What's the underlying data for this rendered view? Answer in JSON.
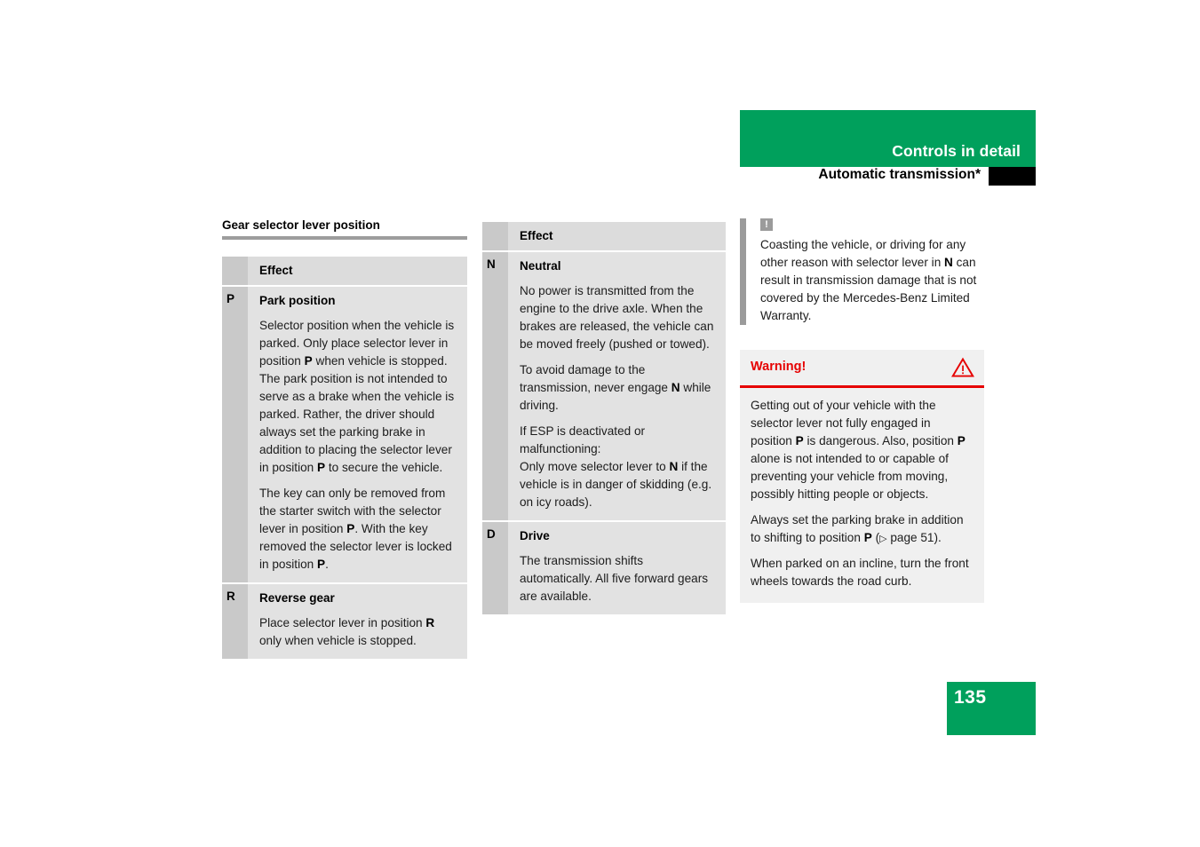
{
  "header": {
    "section_title": "Controls in detail",
    "subtitle": "Automatic transmission*",
    "band_color": "#00a05c",
    "tab_color": "#000000"
  },
  "page_number": "135",
  "section": {
    "title": "Gear selector lever position"
  },
  "tables": [
    {
      "id": "left",
      "header_letter": "",
      "header_label": "Effect",
      "rows": [
        {
          "letter": "P",
          "title": "Park position",
          "paragraphs": [
            "Selector position when the vehicle is parked. Only place selector lever in position <b>P</b> when vehicle is stopped. The park position is not intended to serve as a brake when the vehicle is parked. Rather, the driver should always set the parking brake in addition to placing the selector lever in position <b>P</b> to secure the vehicle.",
            "The key can only be removed from the starter switch with the selector lever in position <b>P</b>. With the key removed the selector lever is locked in position <b>P</b>."
          ]
        },
        {
          "letter": "R",
          "title": "Reverse gear",
          "paragraphs": [
            "Place selector lever in position <b>R</b> only when vehicle is stopped."
          ]
        }
      ]
    },
    {
      "id": "mid",
      "header_letter": "",
      "header_label": "Effect",
      "rows": [
        {
          "letter": "N",
          "title": "Neutral",
          "paragraphs": [
            "No power is transmitted from the engine to the drive axle. When the brakes are released, the vehicle can be moved freely (pushed or towed).",
            "To avoid damage to the transmission, never engage <b>N</b> while driving.",
            "If ESP is deactivated or malfunctioning:<br>Only move selector lever to <b>N</b> if the vehicle is in danger of skidding (e.g. on icy roads)."
          ]
        },
        {
          "letter": "D",
          "title": "Drive",
          "paragraphs": [
            "The transmission shifts automatically. All five forward gears are available."
          ]
        }
      ]
    }
  ],
  "note": {
    "icon": "exclamation-icon",
    "icon_glyph": "!",
    "text": "Coasting the vehicle, or driving for any other reason with selector lever in <b>N</b> can result in transmission damage that is not covered by the Mercedes-Benz Limited Warranty."
  },
  "warning": {
    "title": "Warning!",
    "title_color": "#e60000",
    "icon": "warning-triangle-icon",
    "paragraphs": [
      "Getting out of your vehicle with the selector lever not fully engaged in position <b>P</b> is dangerous. Also, position <b>P</b> alone is not intended to or capable of preventing your vehicle from moving, possibly hitting people or objects.",
      "Always set the parking brake in addition to shifting to position <b>P</b> (<span class=\"ref-arrow\">▷</span> page 51).",
      "When parked on an incline, turn the front wheels towards the road curb."
    ]
  }
}
